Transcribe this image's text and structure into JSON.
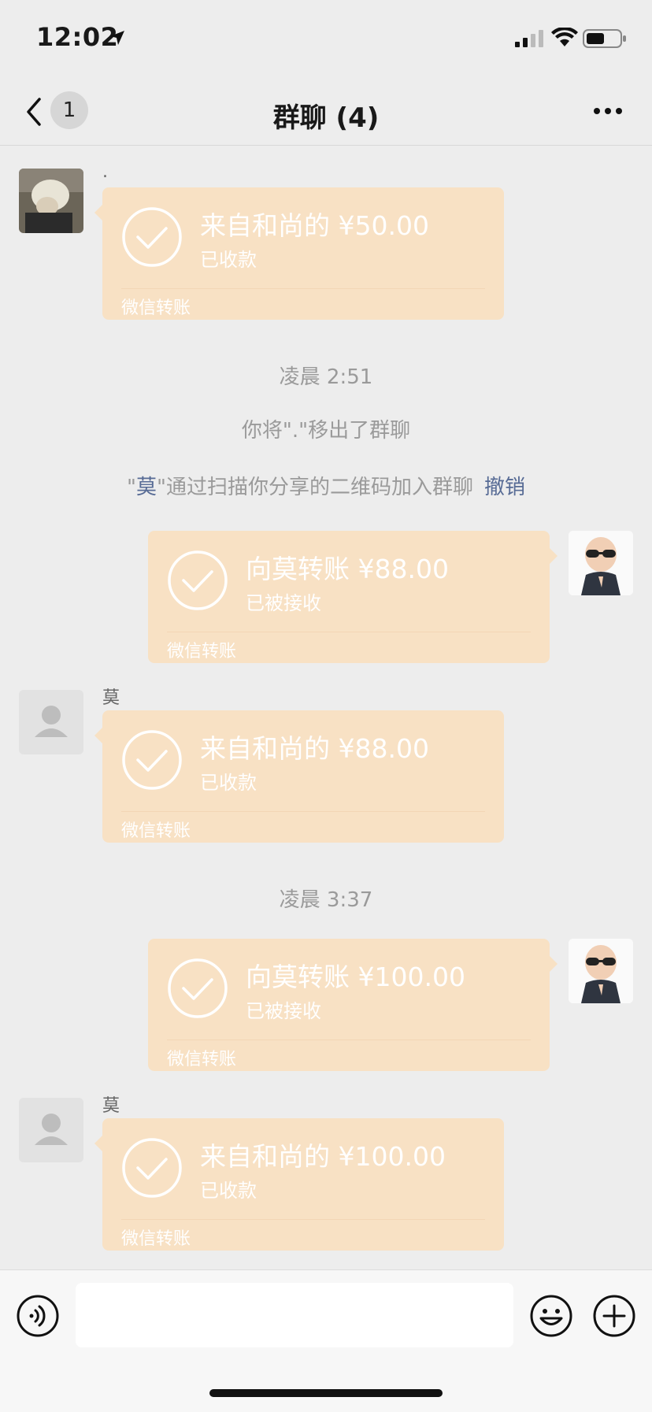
{
  "status_bar": {
    "time": "12:02",
    "icons": [
      "location-arrow-icon",
      "signal-icon",
      "wifi-icon",
      "battery-icon"
    ]
  },
  "nav": {
    "back_badge": "1",
    "title": "群聊 (4)",
    "icons": [
      "back-chevron-icon",
      "more-dots-icon"
    ]
  },
  "colors": {
    "background": "#ededed",
    "transfer_bubble": "#f8e1c4",
    "link": "#576b95",
    "system_text": "#9a9a9a"
  },
  "messages": {
    "m1": {
      "sender": ".",
      "amount": "来自和尚的 ¥50.00",
      "status": "已收款",
      "footer": "微信转账"
    },
    "sys_time1": "凌晨 2:51",
    "sys_removed": "你将\".\"移出了群聊",
    "sys_join": {
      "quote_open": "\"",
      "name": "莫",
      "text": "\"通过扫描你分享的二维码加入群聊",
      "action": "撤销"
    },
    "m2": {
      "amount": "向莫转账 ¥88.00",
      "status": "已被接收",
      "footer": "微信转账"
    },
    "m3": {
      "sender": "莫",
      "amount": "来自和尚的 ¥88.00",
      "status": "已收款",
      "footer": "微信转账"
    },
    "sys_time2": "凌晨 3:37",
    "m4": {
      "amount": "向莫转账 ¥100.00",
      "status": "已被接收",
      "footer": "微信转账"
    },
    "m5": {
      "sender": "莫",
      "amount": "来自和尚的 ¥100.00",
      "status": "已收款",
      "footer": "微信转账"
    }
  },
  "input_bar": {
    "text_value": "",
    "icons": [
      "voice-icon",
      "emoji-icon",
      "plus-icon"
    ]
  }
}
